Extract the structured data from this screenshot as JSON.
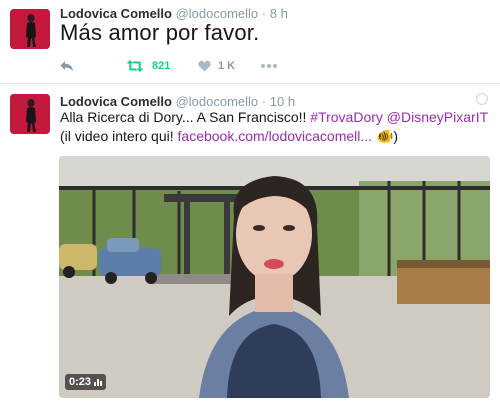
{
  "tweets": [
    {
      "name": "Lodovica Comello",
      "handle": "@lodocomello",
      "time": "8 h",
      "text": "Más amor por favor.",
      "retweets": "821",
      "likes": "1 K"
    },
    {
      "name": "Lodovica Comello",
      "handle": "@lodocomello",
      "time": "10 h",
      "text_prefix": "Alla Ricerca di Dory... A San Francisco!! ",
      "hashtag1": "#TrovaDory",
      "mention": "@DisneyPixarIT",
      "text_middle": "(il video intero qui! ",
      "link": "facebook.com/lodovicacomell...",
      "emoji": "🐠",
      "text_suffix": ")",
      "video_duration": "0:23"
    }
  ],
  "icons": {
    "reply": "reply-icon",
    "retweet": "retweet-icon",
    "like": "heart-icon",
    "more": "more-icon",
    "globe": "globe-icon",
    "volume": "volume-bars-icon"
  },
  "colors": {
    "retweet_green": "#19cf86",
    "link_purple": "#9b2dad",
    "meta_gray": "#8899a6"
  }
}
